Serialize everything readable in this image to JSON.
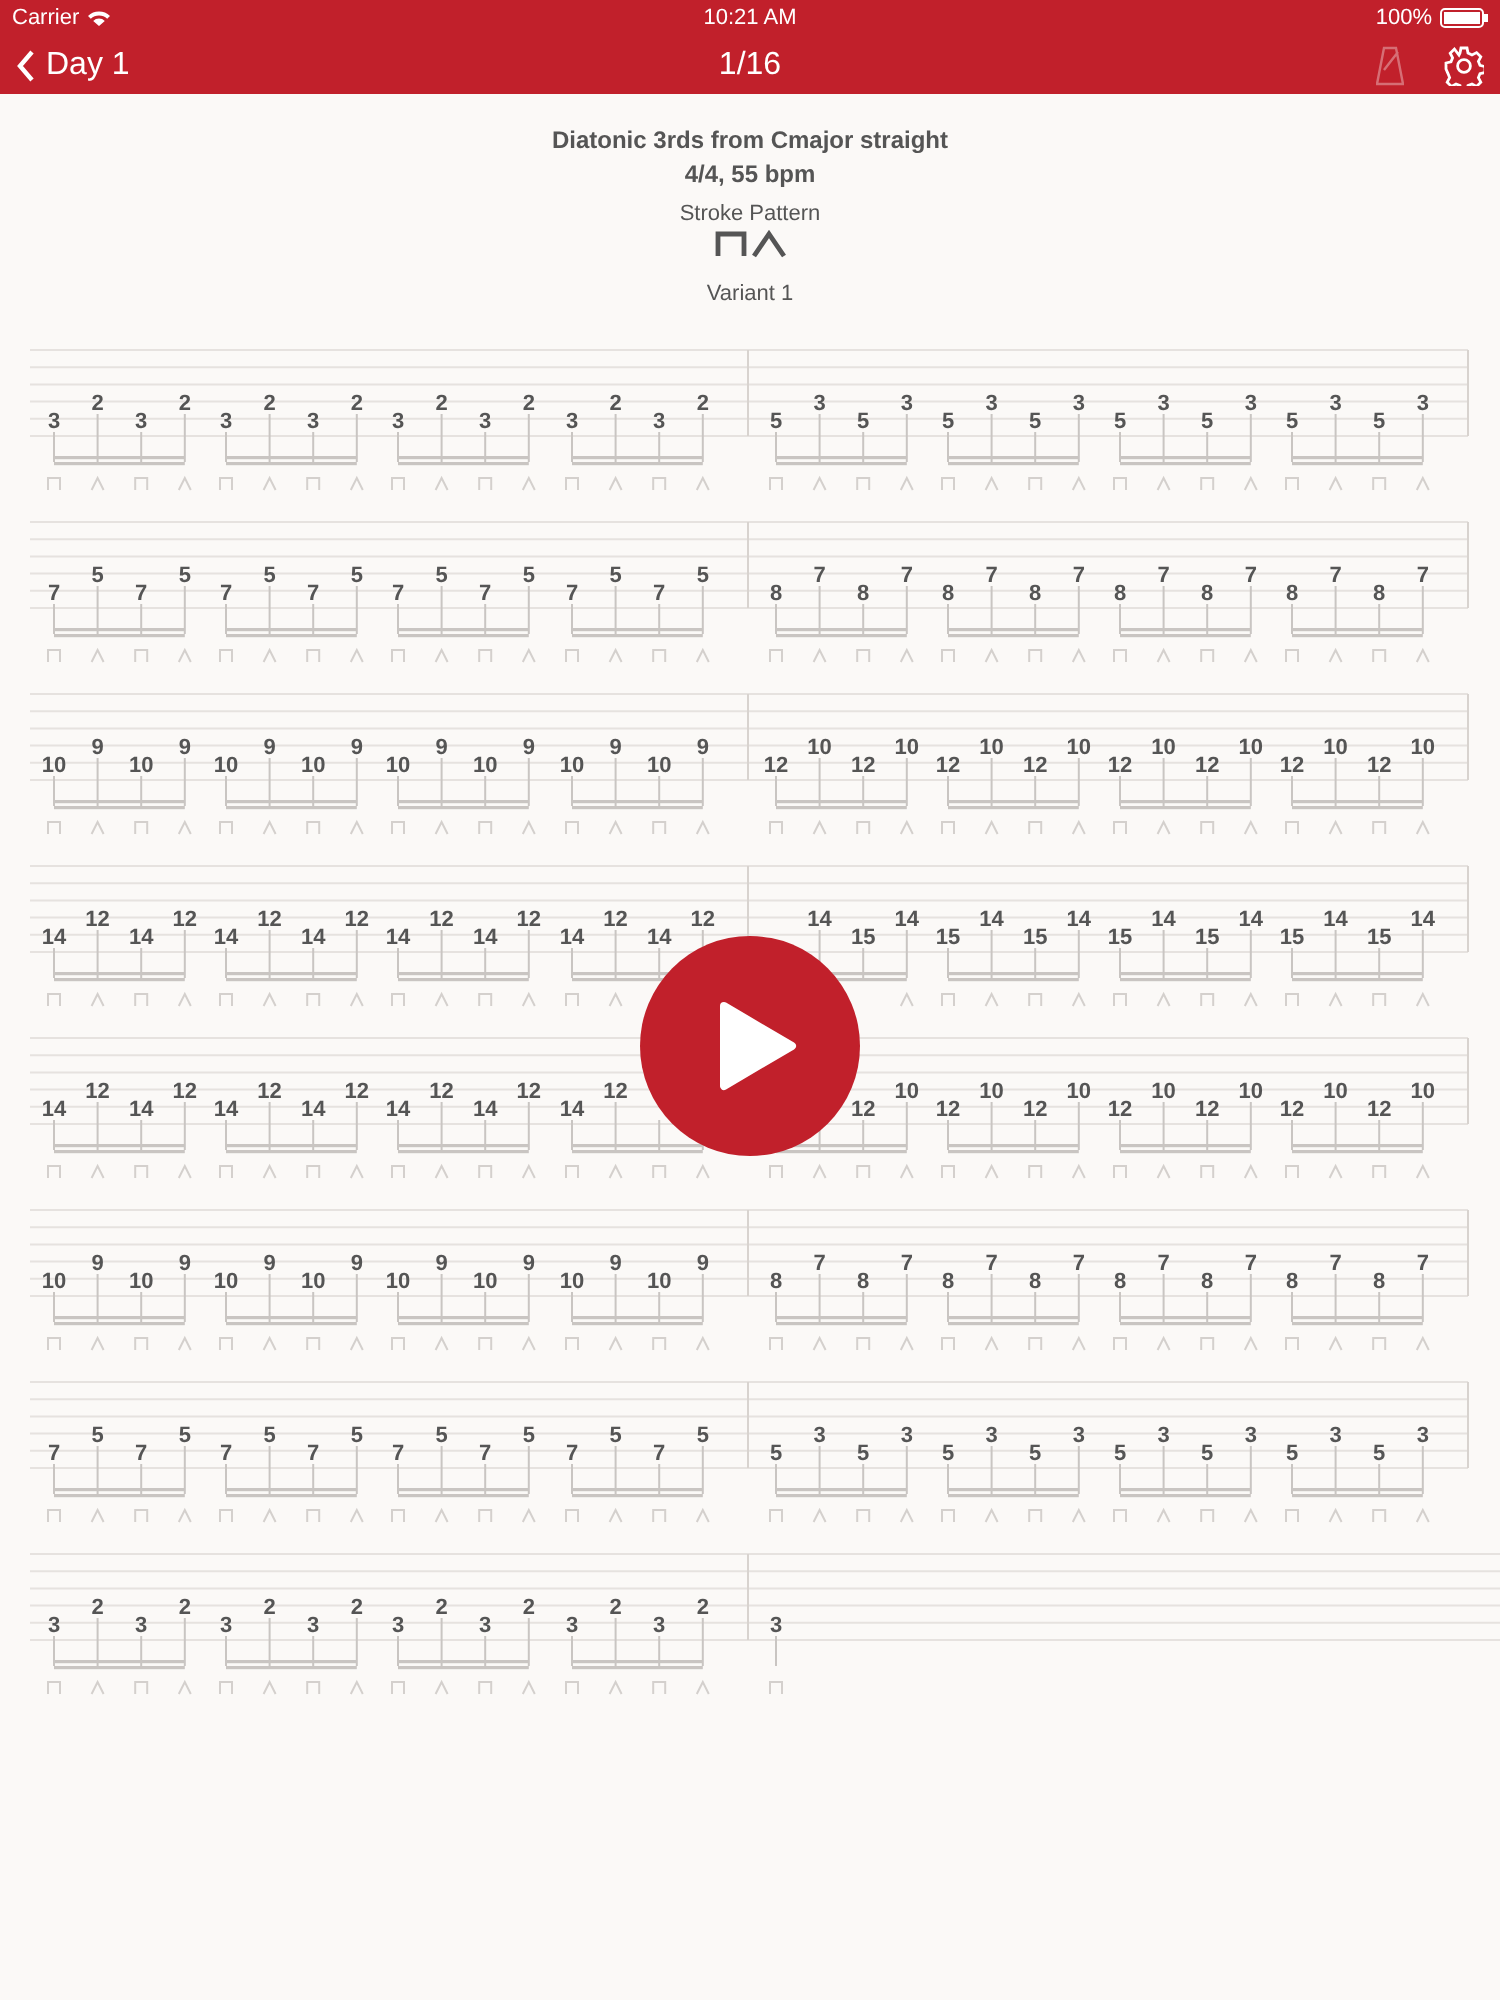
{
  "status_bar": {
    "carrier": "Carrier",
    "time": "10:21 AM",
    "battery": "100%"
  },
  "nav_bar": {
    "back": "Day 1",
    "title": "1/16",
    "metronome": {
      "disabled": true
    }
  },
  "header": {
    "title": "Diatonic 3rds from Cmajor straight",
    "tempo": "4/4, 55 bpm",
    "stroke_pattern_label": "Stroke Pattern",
    "strokes": [
      {
        "kind": "down"
      },
      {
        "kind": "up"
      }
    ],
    "variant": "Variant 1"
  },
  "systems": [
    {
      "measures": [
        {
          "groups": [
            [
              "3",
              "2",
              "3",
              "2"
            ],
            [
              "3",
              "2",
              "3",
              "2"
            ],
            [
              "3",
              "2",
              "3",
              "2"
            ],
            [
              "3",
              "2",
              "3",
              "2"
            ]
          ]
        },
        {
          "groups": [
            [
              "5",
              "3",
              "5",
              "3"
            ],
            [
              "5",
              "3",
              "5",
              "3"
            ],
            [
              "5",
              "3",
              "5",
              "3"
            ],
            [
              "5",
              "3",
              "5",
              "3"
            ]
          ]
        }
      ]
    },
    {
      "measures": [
        {
          "groups": [
            [
              "7",
              "5",
              "7",
              "5"
            ],
            [
              "7",
              "5",
              "7",
              "5"
            ],
            [
              "7",
              "5",
              "7",
              "5"
            ],
            [
              "7",
              "5",
              "7",
              "5"
            ]
          ]
        },
        {
          "groups": [
            [
              "8",
              "7",
              "8",
              "7"
            ],
            [
              "8",
              "7",
              "8",
              "7"
            ],
            [
              "8",
              "7",
              "8",
              "7"
            ],
            [
              "8",
              "7",
              "8",
              "7"
            ]
          ]
        }
      ]
    },
    {
      "measures": [
        {
          "groups": [
            [
              "10",
              "9",
              "10",
              "9"
            ],
            [
              "10",
              "9",
              "10",
              "9"
            ],
            [
              "10",
              "9",
              "10",
              "9"
            ],
            [
              "10",
              "9",
              "10",
              "9"
            ]
          ]
        },
        {
          "groups": [
            [
              "12",
              "10",
              "12",
              "10"
            ],
            [
              "12",
              "10",
              "12",
              "10"
            ],
            [
              "12",
              "10",
              "12",
              "10"
            ],
            [
              "12",
              "10",
              "12",
              "10"
            ]
          ]
        }
      ]
    },
    {
      "measures": [
        {
          "groups": [
            [
              "14",
              "12",
              "14",
              "12"
            ],
            [
              "14",
              "12",
              "14",
              "12"
            ],
            [
              "14",
              "12",
              "14",
              "12"
            ],
            [
              "14",
              "12",
              "14",
              "12"
            ]
          ]
        },
        {
          "groups": [
            {
              "frets": [
                "14",
                "15",
                "14"
              ],
              "kind": "tail"
            },
            [
              "15",
              "14",
              "15",
              "14"
            ],
            [
              "15",
              "14",
              "15",
              "14"
            ],
            [
              "15",
              "14",
              "15",
              "14"
            ]
          ]
        }
      ]
    },
    {
      "measures": [
        {
          "groups": [
            [
              "14",
              "12",
              "14",
              "12"
            ],
            [
              "14",
              "12",
              "14",
              "12"
            ],
            [
              "14",
              "12",
              "14",
              "12"
            ],
            {
              "frets": [
                "14",
                "12"
              ],
              "kind": "head"
            }
          ]
        },
        {
          "groups": [
            {
              "frets": [
                "12",
                "10"
              ],
              "kind": "tail"
            },
            [
              "12",
              "10",
              "12",
              "10"
            ],
            [
              "12",
              "10",
              "12",
              "10"
            ],
            [
              "12",
              "10",
              "12",
              "10"
            ]
          ]
        }
      ]
    },
    {
      "measures": [
        {
          "groups": [
            [
              "10",
              "9",
              "10",
              "9"
            ],
            [
              "10",
              "9",
              "10",
              "9"
            ],
            [
              "10",
              "9",
              "10",
              "9"
            ],
            [
              "10",
              "9",
              "10",
              "9"
            ]
          ]
        },
        {
          "groups": [
            [
              "8",
              "7",
              "8",
              "7"
            ],
            [
              "8",
              "7",
              "8",
              "7"
            ],
            [
              "8",
              "7",
              "8",
              "7"
            ],
            [
              "8",
              "7",
              "8",
              "7"
            ]
          ]
        }
      ]
    },
    {
      "measures": [
        {
          "groups": [
            [
              "7",
              "5",
              "7",
              "5"
            ],
            [
              "7",
              "5",
              "7",
              "5"
            ],
            [
              "7",
              "5",
              "7",
              "5"
            ],
            [
              "7",
              "5",
              "7",
              "5"
            ]
          ]
        },
        {
          "groups": [
            [
              "5",
              "3",
              "5",
              "3"
            ],
            [
              "5",
              "3",
              "5",
              "3"
            ],
            [
              "5",
              "3",
              "5",
              "3"
            ],
            [
              "5",
              "3",
              "5",
              "3"
            ]
          ]
        }
      ]
    },
    {
      "measures": [
        {
          "groups": [
            [
              "3",
              "2",
              "3",
              "2"
            ],
            [
              "3",
              "2",
              "3",
              "2"
            ],
            [
              "3",
              "2",
              "3",
              "2"
            ],
            [
              "3",
              "2",
              "3",
              "2"
            ]
          ]
        },
        {
          "groups": [
            [
              "3"
            ]
          ]
        }
      ]
    }
  ]
}
